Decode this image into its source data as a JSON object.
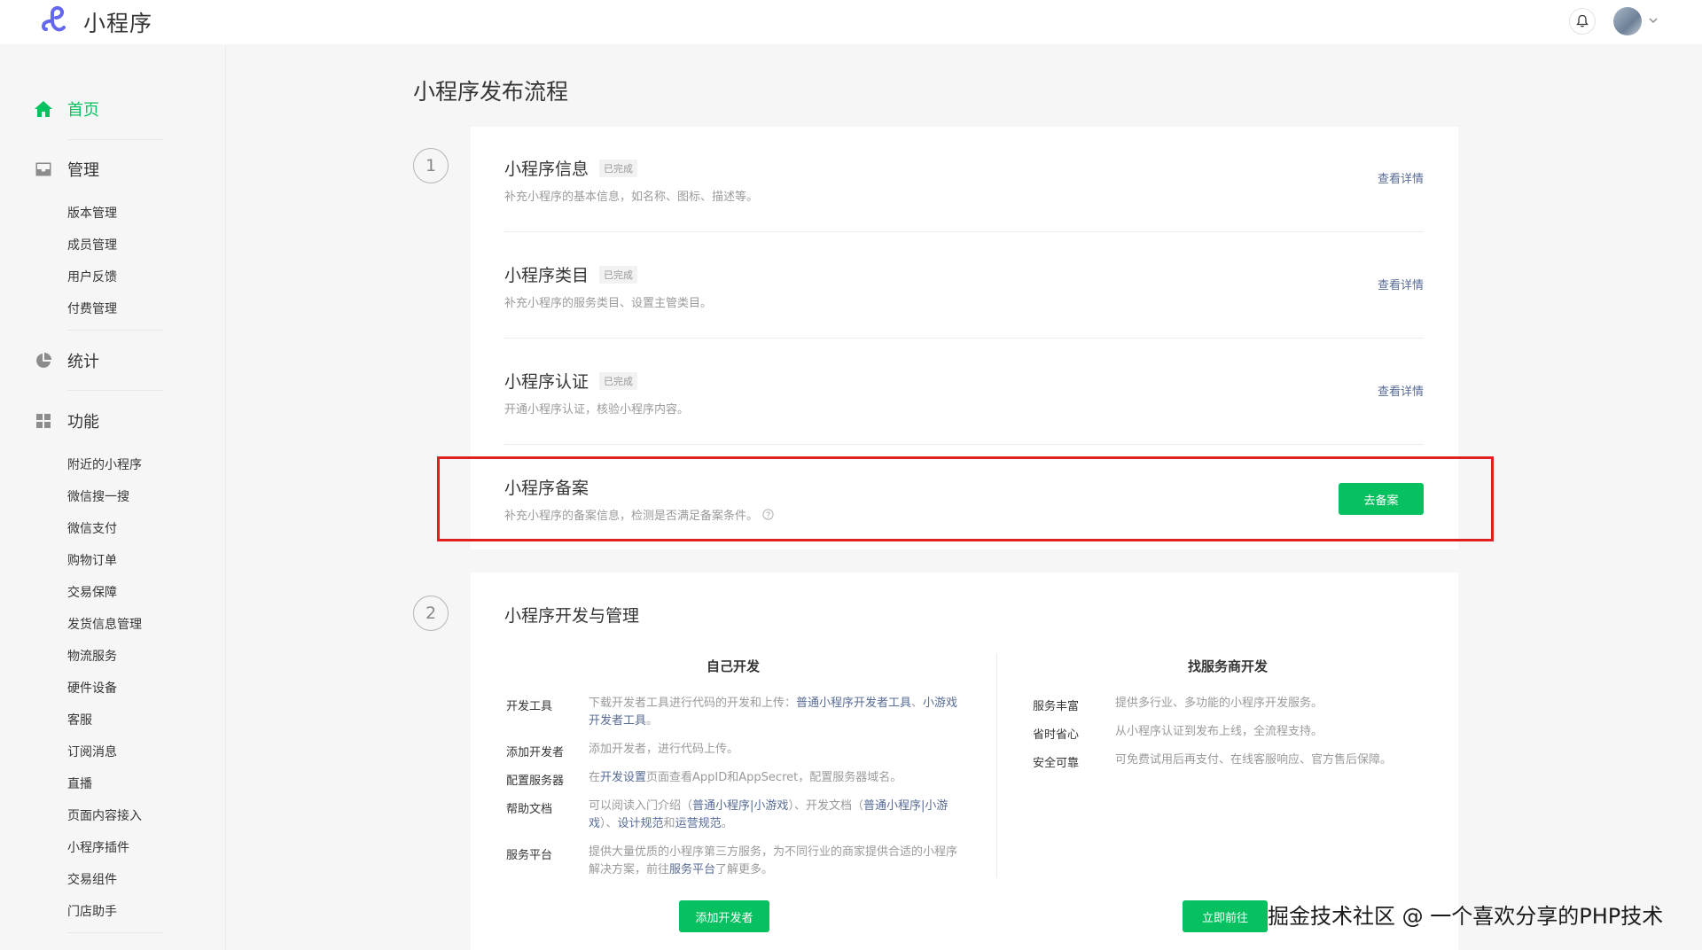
{
  "header": {
    "app_name": "小程序",
    "logo_icon": "miniprogram-logo-icon",
    "bell_icon": "bell-icon",
    "avatar_caret_icon": "chevron-down-icon"
  },
  "sidebar": {
    "home": {
      "label": "首页",
      "icon": "home-icon"
    },
    "manage": {
      "label": "管理",
      "icon": "inbox-icon",
      "items": [
        "版本管理",
        "成员管理",
        "用户反馈",
        "付费管理"
      ]
    },
    "stats": {
      "label": "统计",
      "icon": "pie-chart-icon"
    },
    "features": {
      "label": "功能",
      "icon": "grid-icon",
      "items": [
        "附近的小程序",
        "微信搜一搜",
        "微信支付",
        "购物订单",
        "交易保障",
        "发货信息管理",
        "物流服务",
        "硬件设备",
        "客服",
        "订阅消息",
        "直播",
        "页面内容接入",
        "小程序插件",
        "交易组件",
        "门店助手"
      ]
    }
  },
  "main": {
    "page_title": "小程序发布流程",
    "step1": {
      "number": "1",
      "items": [
        {
          "title": "小程序信息",
          "badge": "已完成",
          "desc": "补充小程序的基本信息，如名称、图标、描述等。",
          "link": "查看详情"
        },
        {
          "title": "小程序类目",
          "badge": "已完成",
          "desc": "补充小程序的服务类目、设置主管类目。",
          "link": "查看详情"
        },
        {
          "title": "小程序认证",
          "badge": "已完成",
          "desc": "开通小程序认证，核验小程序内容。",
          "link": "查看详情"
        },
        {
          "title": "小程序备案",
          "desc": "补充小程序的备案信息，检测是否满足备案条件。",
          "button": "去备案",
          "help_icon": "question-circle-icon"
        }
      ]
    },
    "step2": {
      "number": "2",
      "title": "小程序开发与管理",
      "self_dev": {
        "title": "自己开发",
        "rows": [
          {
            "key": "开发工具",
            "text_a": "下载开发者工具进行代码的开发和上传：",
            "link_a": "普通小程序开发者工具",
            "text_b": "、",
            "link_b": "小游戏开发者工具",
            "text_c": "。"
          },
          {
            "key": "添加开发者",
            "text": "添加开发者，进行代码上传。"
          },
          {
            "key": "配置服务器",
            "text_a": "在",
            "link_a": "开发设置",
            "text_b": "页面查看AppID和AppSecret，配置服务器域名。"
          },
          {
            "key": "帮助文档",
            "text_a": "可以阅读入门介绍（",
            "link_a": "普通小程序",
            "sep_a": "|",
            "link_b": "小游戏",
            "text_b": "）、开发文档（",
            "link_c": "普通小程序",
            "sep_b": "|",
            "link_d": "小游戏",
            "text_c": "）、",
            "link_e": "设计规范",
            "text_d": "和",
            "link_f": "运营规范",
            "text_e": "。"
          },
          {
            "key": "服务平台",
            "text_a": "提供大量优质的小程序第三方服务，为不同行业的商家提供合适的小程序解决方案，前往",
            "link_a": "服务平台",
            "text_b": "了解更多。"
          }
        ],
        "button": "添加开发者"
      },
      "vendor_dev": {
        "title": "找服务商开发",
        "rows": [
          {
            "key": "服务丰富",
            "text": "提供多行业、多功能的小程序开发服务。"
          },
          {
            "key": "省时省心",
            "text": "从小程序认证到发布上线，全流程支持。"
          },
          {
            "key": "安全可靠",
            "text": "可免费试用后再支付、在线客服响应、官方售后保障。"
          }
        ],
        "button": "立即前往"
      }
    }
  },
  "watermark": "掘金技术社区 @ 一个喜欢分享的PHP技术",
  "colors": {
    "brand_green": "#07c160",
    "link_blue": "#576b95",
    "highlight_red": "#e02020"
  }
}
